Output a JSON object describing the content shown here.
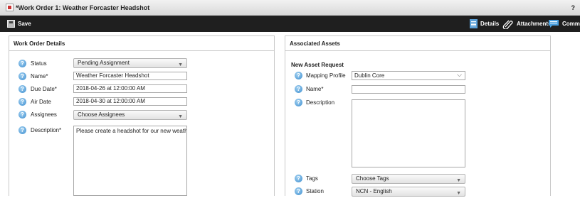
{
  "window": {
    "title": "*Work Order 1: Weather Forcaster Headshot",
    "help": "?"
  },
  "toolbar": {
    "save": "Save",
    "details": "Details",
    "attachments": "Attachments",
    "comments": "Comme"
  },
  "details": {
    "heading": "Work Order Details",
    "status_label": "Status",
    "status_value": "Pending Assignment",
    "name_label": "Name*",
    "name_value": "Weather Forcaster Headshot",
    "due_label": "Due Date*",
    "due_value": "2018-04-26 at 12:00:00 AM",
    "air_label": "Air Date",
    "air_value": "2018-04-30 at 12:00:00 AM",
    "assignees_label": "Assignees",
    "assignees_value": "Choose Assignees",
    "desc_label": "Description*",
    "desc_value": "Please create a headshot for our new weather"
  },
  "assets": {
    "heading": "Associated Assets",
    "subheading": "New Asset Request",
    "mapping_label": "Mapping Profile",
    "mapping_value": "Dublin Core",
    "name_label": "Name*",
    "name_value": "",
    "desc_label": "Description",
    "desc_value": "",
    "tags_label": "Tags",
    "tags_value": "Choose Tags",
    "station_label": "Station",
    "station_value": "NCN - English"
  },
  "icons": {
    "help": "help-icon",
    "save": "save-icon",
    "details": "document-icon",
    "attachments": "paperclip-icon",
    "comments": "chat-bubble-icon"
  }
}
